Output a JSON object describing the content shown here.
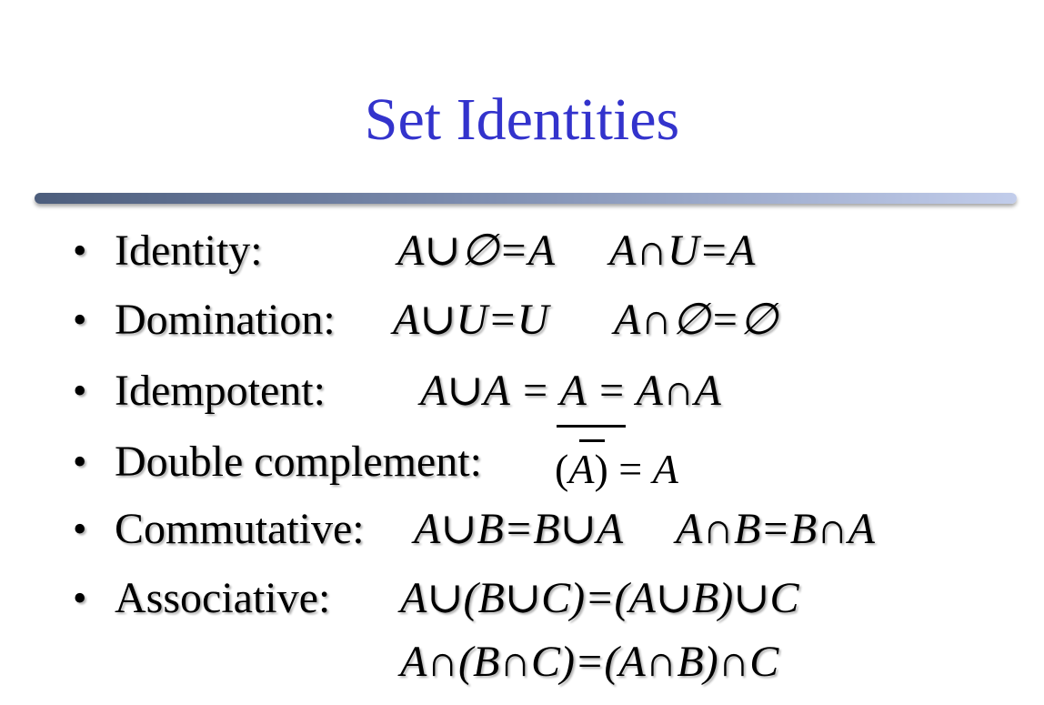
{
  "title": "Set Identities",
  "bullet_char": "•",
  "identities": [
    {
      "label": "Identity:",
      "formulas": [
        "A∪∅=A",
        "A∩U=A"
      ]
    },
    {
      "label": "Domination:",
      "formulas": [
        "A∪U=U",
        "A∩∅=∅"
      ]
    },
    {
      "label": "Idempotent:",
      "formulas": [
        "A∪A = A = A∩A"
      ]
    },
    {
      "label": "Double complement:",
      "formula_parts": [
        "(",
        "A",
        ")",
        " = ",
        "A"
      ]
    },
    {
      "label": "Commutative:",
      "formulas": [
        "A∪B=B∪A",
        "A∩B=B∩A"
      ]
    },
    {
      "label": "Associative:",
      "formulas": [
        "A∪(B∪C)=(A∪B)∪C",
        "A∩(B∩C)=(A∩B)∩C"
      ]
    }
  ],
  "colors": {
    "title": "#3333cc",
    "text": "#000000",
    "rule_start": "#4c5d7c",
    "rule_end": "#c2cdeb"
  }
}
